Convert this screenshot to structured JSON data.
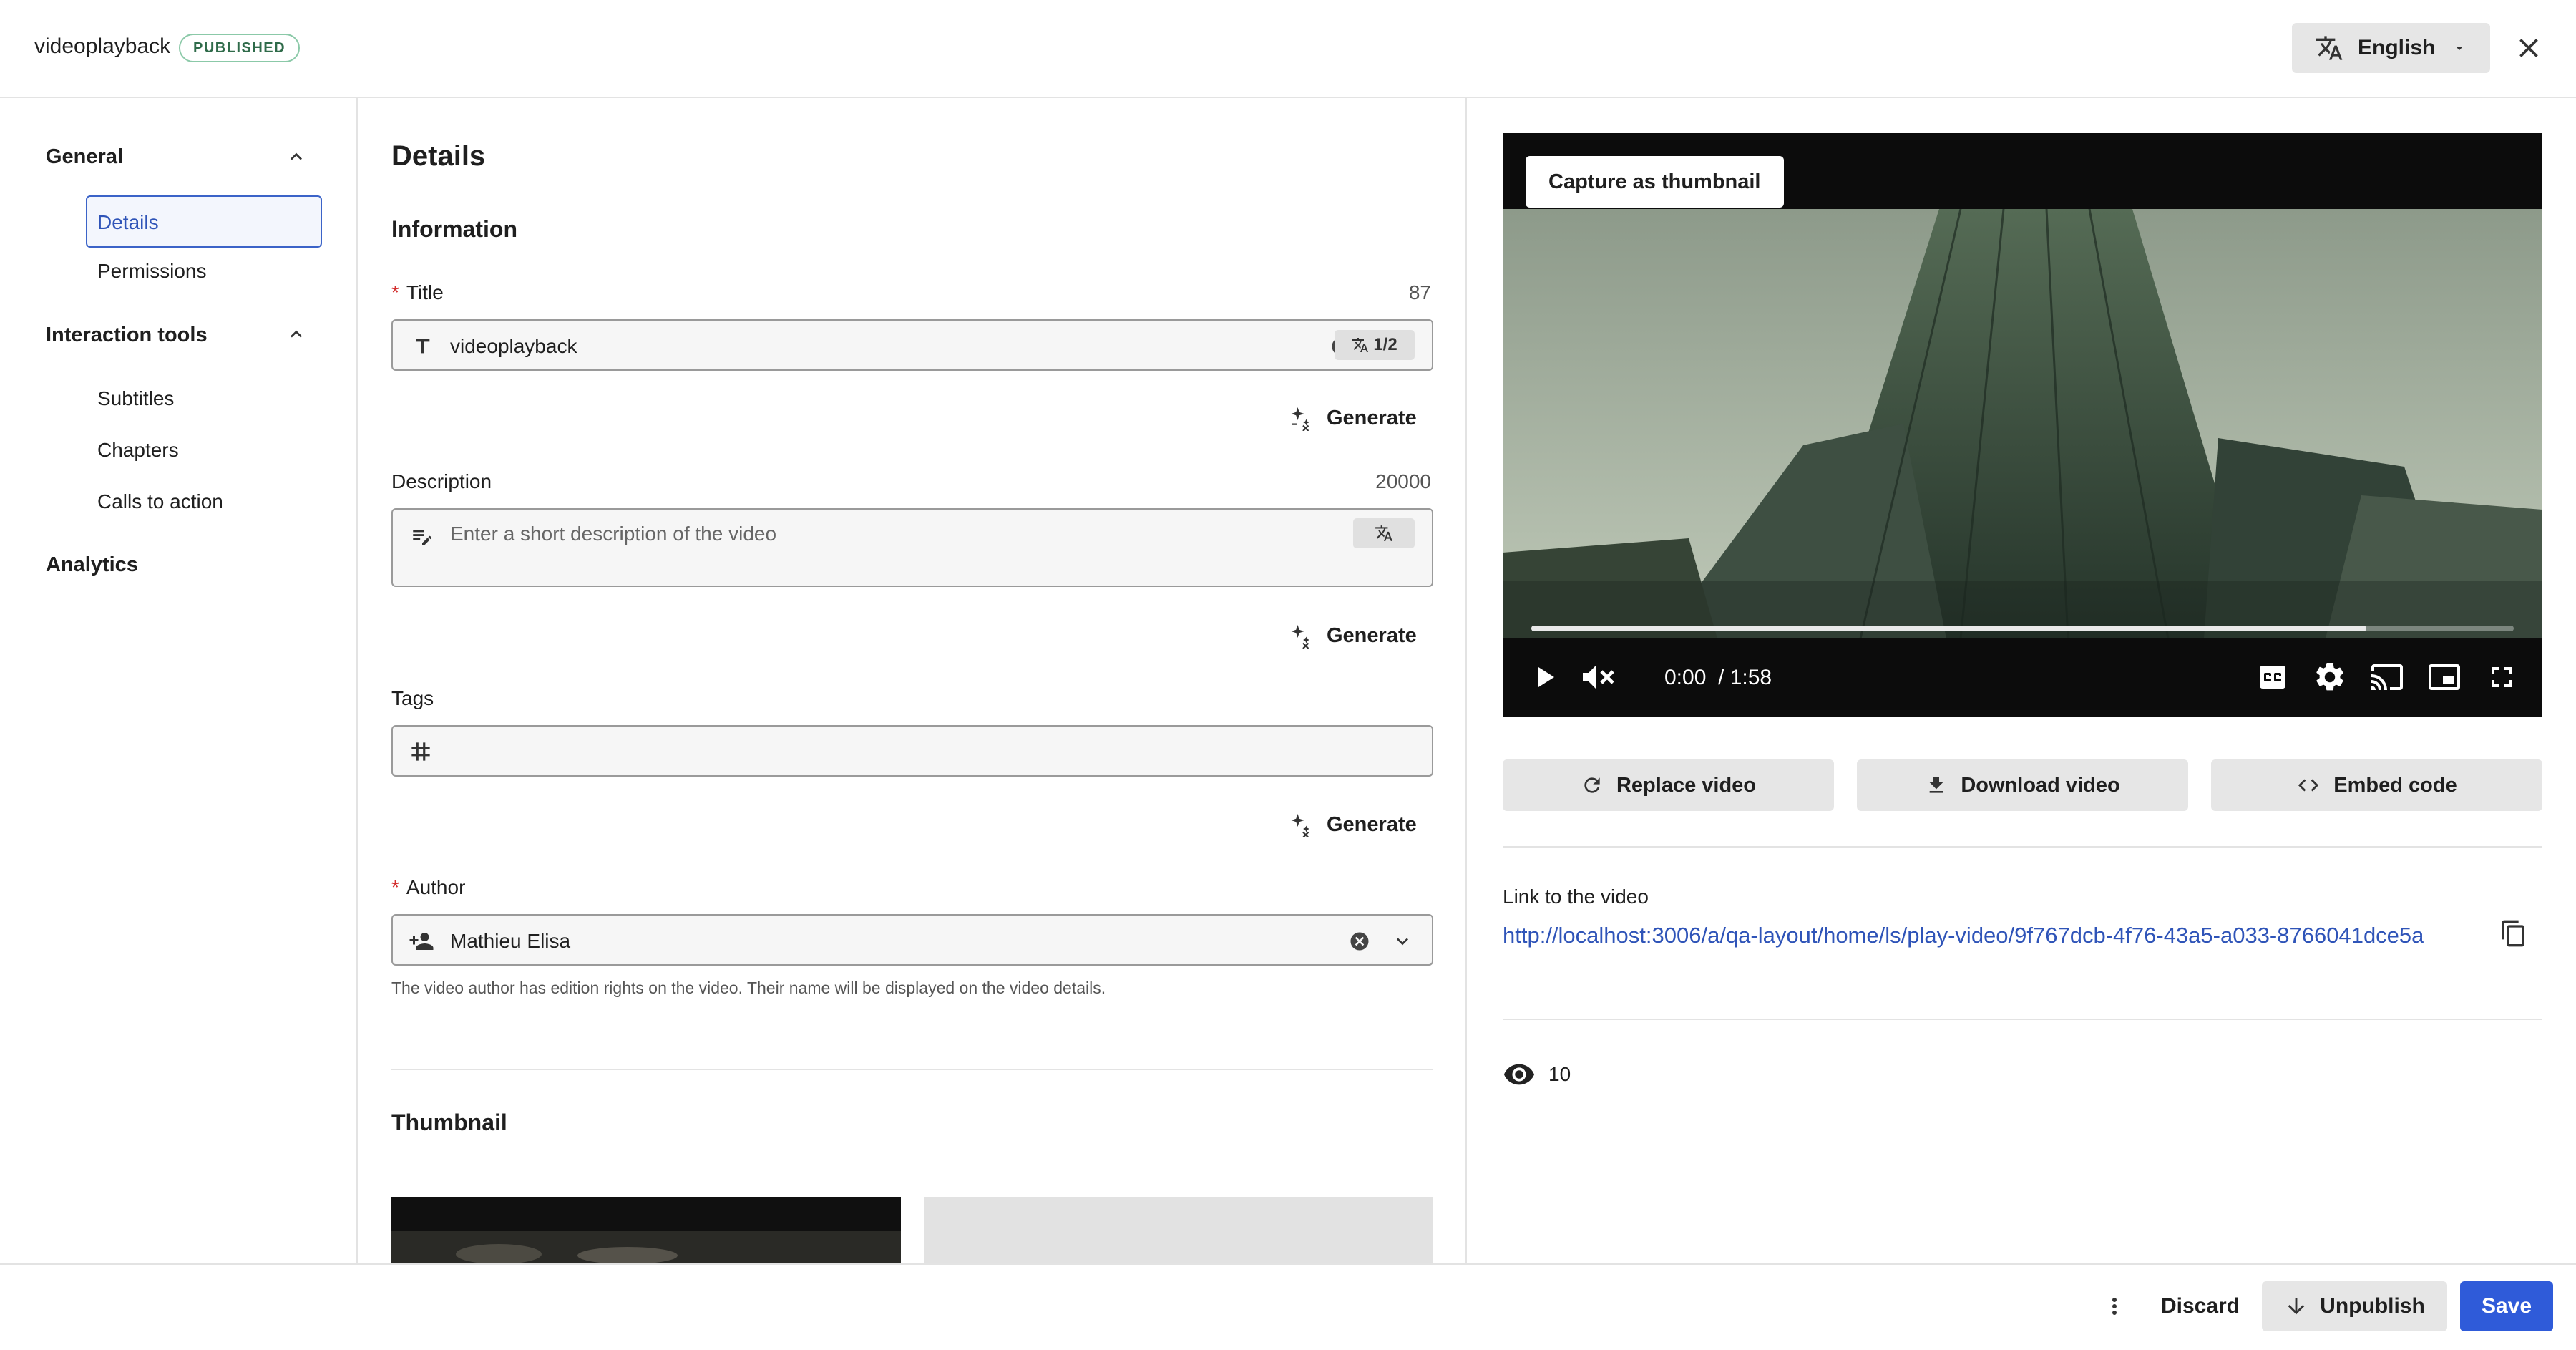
{
  "header": {
    "title": "videoplayback",
    "status_badge": "PUBLISHED",
    "language": "English"
  },
  "sidebar": {
    "sections": [
      {
        "label": "General",
        "items": [
          "Details",
          "Permissions"
        ]
      },
      {
        "label": "Interaction tools",
        "items": [
          "Subtitles",
          "Chapters",
          "Calls to action"
        ]
      },
      {
        "label": "Analytics",
        "items": []
      }
    ],
    "active_item": "Details"
  },
  "details": {
    "heading": "Details",
    "information_heading": "Information",
    "title_field": {
      "label": "Title",
      "counter": "87",
      "value": "videoplayback",
      "translation_badge": "1/2"
    },
    "generate_label": "Generate",
    "description_field": {
      "label": "Description",
      "counter": "20000",
      "placeholder": "Enter a short description of the video"
    },
    "tags_field": {
      "label": "Tags"
    },
    "author_field": {
      "label": "Author",
      "value": "Mathieu Elisa",
      "help": "The video author has edition rights on the video. Their name will be displayed on the video details."
    },
    "thumbnail_heading": "Thumbnail"
  },
  "player": {
    "capture_label": "Capture as thumbnail",
    "current_time": "0:00",
    "duration": "/ 1:58",
    "progress": 0.85
  },
  "actions": {
    "replace": "Replace video",
    "download": "Download video",
    "embed": "Embed code"
  },
  "link": {
    "label": "Link to the video",
    "url": "http://localhost:3006/a/qa-layout/home/ls/play-video/9f767dcb-4f76-43a5-a033-8766041dce5a"
  },
  "views": {
    "count": "10"
  },
  "footer": {
    "discard": "Discard",
    "unpublish": "Unpublish",
    "save": "Save"
  },
  "colors": {
    "primary": "#2f5bd9",
    "link": "#2f54b8",
    "success_badge": "#2f6b4a"
  }
}
